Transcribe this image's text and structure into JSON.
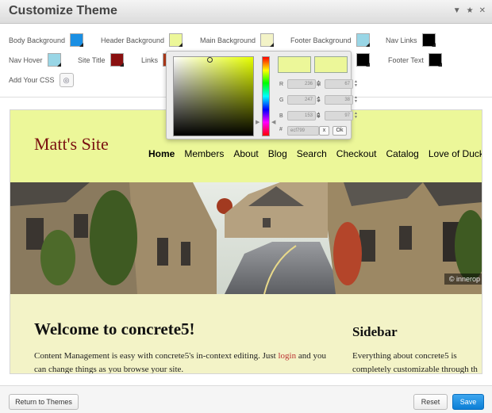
{
  "dialog": {
    "title": "Customize Theme",
    "icons": [
      "arrow-down-icon",
      "star-icon",
      "close-icon"
    ]
  },
  "options": {
    "body_background": {
      "label": "Body Background",
      "color": "#1a8fe3"
    },
    "header_background": {
      "label": "Header Background",
      "color": "#ecf799"
    },
    "main_background": {
      "label": "Main Background",
      "color": "#f3f3c7"
    },
    "footer_background": {
      "label": "Footer Background",
      "color": "#99d6e6"
    },
    "nav_links": {
      "label": "Nav Links",
      "color": "#000000"
    },
    "nav_hover": {
      "label": "Nav Hover",
      "color": "#99d6e6"
    },
    "site_title": {
      "label": "Site Title",
      "color": "#8a1010"
    },
    "links": {
      "label": "Links",
      "color": "#b33a1a"
    },
    "footer_text": {
      "label": "Footer Text",
      "color": "#000000"
    },
    "add_css": {
      "label": "Add Your CSS"
    }
  },
  "picker": {
    "r": "236",
    "g": "247",
    "b": "153",
    "h": "67",
    "s": "38",
    "v": "97",
    "r_label": "R",
    "g_label": "G",
    "b_label": "B",
    "h_label": "H",
    "s_label": "S",
    "v_label": "B",
    "hash_label": "#",
    "hex": "ecf799",
    "cancel_label": "x",
    "ok_label": "Ok",
    "current_color": "#ecf799",
    "new_color": "#ecf799"
  },
  "preview": {
    "site_title": "Matt's Site",
    "nav": [
      "Home",
      "Members",
      "About",
      "Blog",
      "Search",
      "Checkout",
      "Catalog",
      "Love of Duck",
      "Te"
    ],
    "credit": "© innerop",
    "welcome_title": "Welcome to concrete5!",
    "body_text_before": "Content Management is easy with concrete5's in-context editing. Just ",
    "body_link": "login",
    "body_text_after": " and you can change things as you browse your site.",
    "sidebar_title": "Sidebar",
    "sidebar_line1": "Everything about concrete5 is",
    "sidebar_line2": "completely customizable through th"
  },
  "footer": {
    "return_label": "Return to Themes",
    "reset_label": "Reset",
    "save_label": "Save"
  }
}
